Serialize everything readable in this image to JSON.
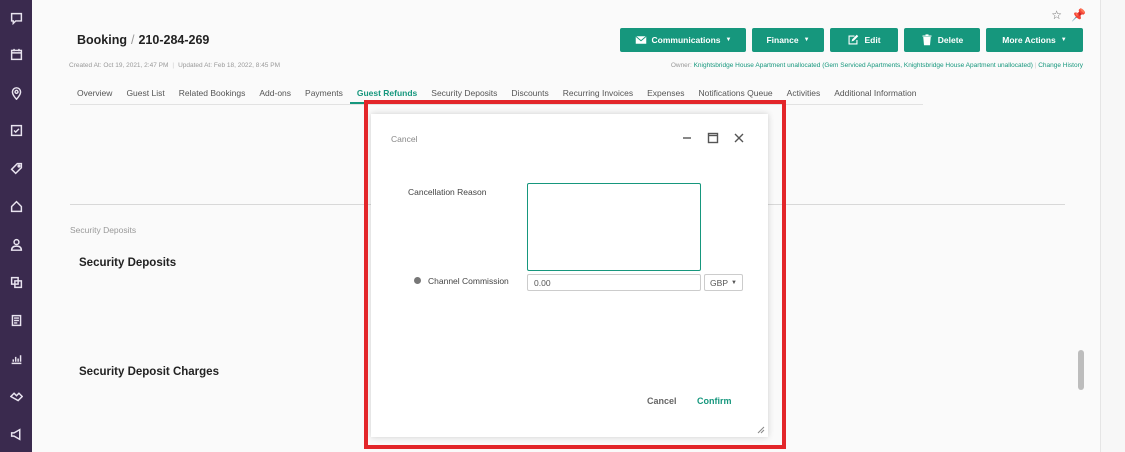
{
  "sidebar": {
    "items": [
      "chat-icon",
      "calendar-icon",
      "location-pin-icon",
      "checklist-icon",
      "tag-icon",
      "home-icon",
      "user-icon",
      "copy-icon",
      "document-icon",
      "chart-icon",
      "handshake-icon",
      "megaphone-icon"
    ]
  },
  "booking": {
    "section": "Booking",
    "separator": "/",
    "number": "210-284-269",
    "created": "Created At: Oct 19, 2021, 2:47 PM",
    "updated": "Updated At: Feb 18, 2022, 8:45 PM",
    "owner_prefix": "Owner:",
    "owner_link": "Knightsbridge House Apartment unallocated (Gem Serviced Apartments, Knightsbridge House Apartment unallocated)",
    "change_history": "Change History"
  },
  "actions": {
    "communications": "Communications",
    "finance": "Finance",
    "edit": "Edit",
    "delete": "Delete",
    "more_actions": "More Actions"
  },
  "tabs": [
    "Overview",
    "Guest List",
    "Related Bookings",
    "Add-ons",
    "Payments",
    "Guest Refunds",
    "Security Deposits",
    "Discounts",
    "Recurring Invoices",
    "Expenses",
    "Notifications Queue",
    "Activities",
    "Additional Information"
  ],
  "active_tab": "Guest Refunds",
  "sections": {
    "small_label": "Security Deposits",
    "title1": "Security Deposits",
    "title2": "Security Deposit Charges"
  },
  "modal": {
    "title": "Cancel",
    "reason_label": "Cancellation Reason",
    "reason_value": "",
    "commission_label": "Channel Commission",
    "commission_value": "0.00",
    "currency": "GBP",
    "cancel_label": "Cancel",
    "confirm_label": "Confirm"
  },
  "colors": {
    "accent": "#16977d",
    "sidebar": "#3a2a4e",
    "highlight": "#e3262a"
  }
}
